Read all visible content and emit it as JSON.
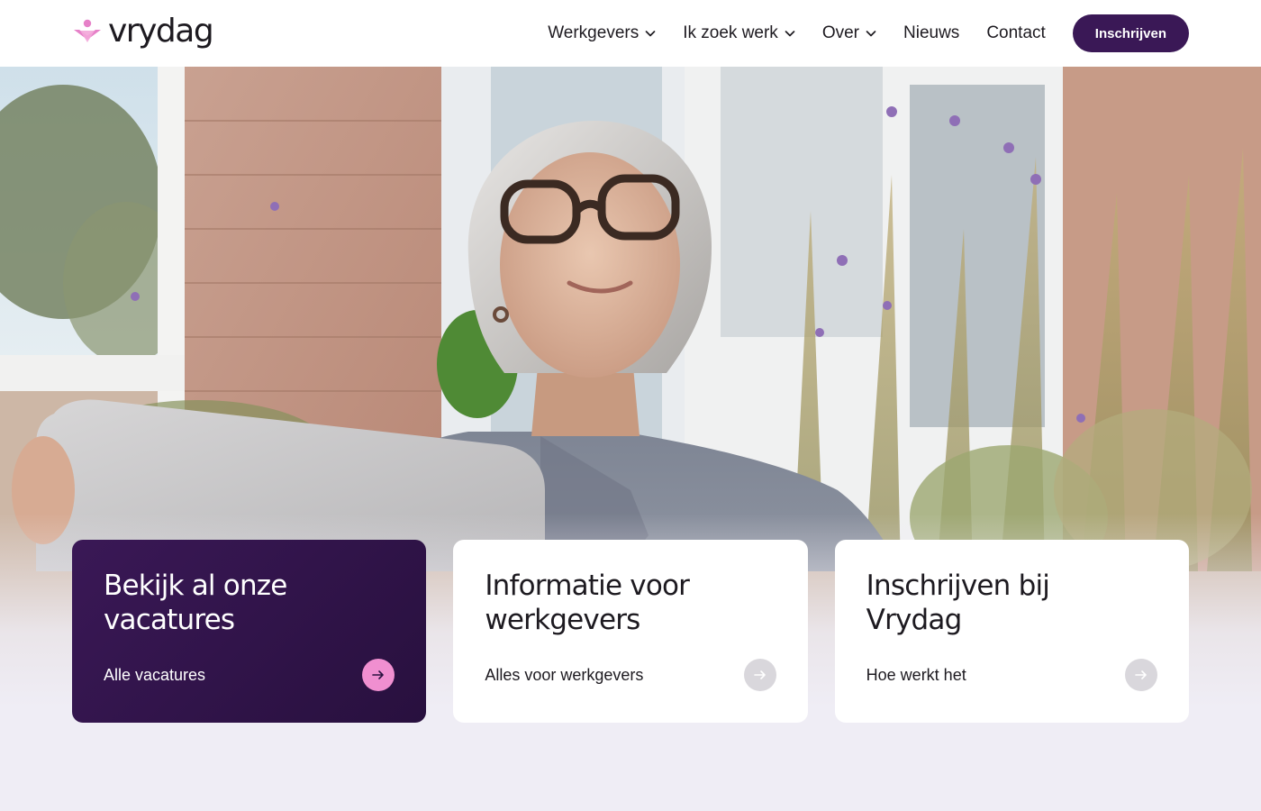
{
  "header": {
    "logo_text": "vrydag",
    "nav": [
      {
        "label": "Werkgevers",
        "has_dropdown": true
      },
      {
        "label": "Ik zoek werk",
        "has_dropdown": true
      },
      {
        "label": "Over",
        "has_dropdown": true
      },
      {
        "label": "Nieuws",
        "has_dropdown": false
      },
      {
        "label": "Contact",
        "has_dropdown": false
      }
    ],
    "cta_label": "Inschrijven"
  },
  "hero": {
    "image_subject": "woman with glasses holding a laptop, seated outdoors in front of a brick house with windows and plants"
  },
  "cards": [
    {
      "title_line1": "Bekijk al onze",
      "title_line2": "vacatures",
      "link": "Alle vacatures",
      "style": "dark"
    },
    {
      "title_line1": "Informatie voor",
      "title_line2": "werkgevers",
      "link": "Alles voor werkgevers",
      "style": "light"
    },
    {
      "title_line1": "Inschrijven bij",
      "title_line2": "Vrydag",
      "link": "Hoe werkt het",
      "style": "light"
    }
  ],
  "colors": {
    "brand_purple": "#3a1856",
    "accent_pink": "#f08fd0",
    "page_background": "#efedf5"
  },
  "icons": [
    "vrydag-logo-mark",
    "chevron-down-icon",
    "arrow-right-icon"
  ]
}
